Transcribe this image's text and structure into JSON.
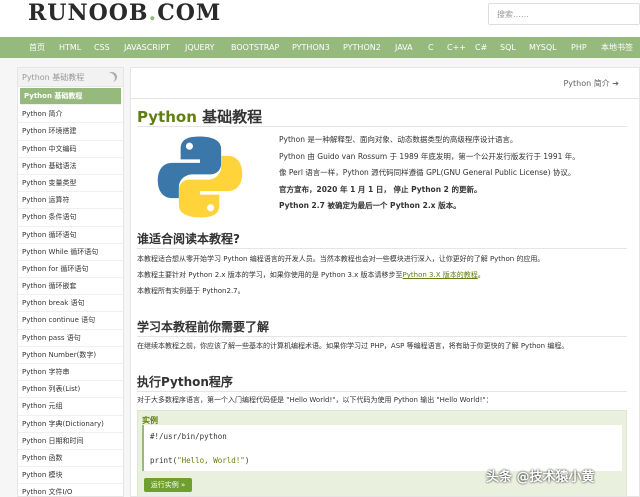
{
  "site": {
    "logo_main": "RUNOOB",
    "logo_dot": ".",
    "logo_tld": "COM",
    "search_placeholder": "搜索……"
  },
  "nav": [
    "首页",
    "HTML",
    "CSS",
    "JAVASCRIPT",
    "JQUERY",
    "BOOTSTRAP",
    "PYTHON3",
    "PYTHON2",
    "JAVA",
    "C",
    "C++",
    "C#",
    "SQL",
    "MYSQL",
    "PHP",
    "本地书签"
  ],
  "sidebar": {
    "title": "Python 基础教程",
    "items": [
      "Python 基础教程",
      "Python 简介",
      "Python 环境搭建",
      "Python 中文编码",
      "Python 基础语法",
      "Python 变量类型",
      "Python 运算符",
      "Python 条件语句",
      "Python 循环语句",
      "Python While 循环语句",
      "Python for 循环语句",
      "Python 循环嵌套",
      "Python break 语句",
      "Python continue 语句",
      "Python pass 语句",
      "Python Number(数字)",
      "Python 字符串",
      "Python 列表(List)",
      "Python 元组",
      "Python 字典(Dictionary)",
      "Python 日期和时间",
      "Python 函数",
      "Python 模块",
      "Python 文件I/O"
    ]
  },
  "main": {
    "next_link": "Python 简介 ➔",
    "title_part1": "Python",
    "title_part2": " 基础教程",
    "intro": [
      "Python 是一种解释型、面向对象、动态数据类型的高级程序设计语言。",
      "Python 由 Guido van Rossum 于 1989 年底发明，第一个公开发行版发行于 1991 年。",
      "像 Perl 语言一样，Python 源代码同样遵循 GPL(GNU General Public License) 协议。",
      "官方宣布，2020 年 1 月 1 日， 停止 Python 2 的更新。",
      "Python 2.7 被确定为最后一个 Python 2.x 版本。"
    ],
    "section1_title": "谁适合阅读本教程?",
    "section1_p1": "本教程适合想从零开始学习 Python 编程语言的开发人员。当然本教程也会对一些模块进行深入，让你更好的了解 Python 的应用。",
    "section1_p2_pre": "本教程主要针对 Python 2.x 版本的学习，如果你使用的是 Python 3.x 版本请移步至",
    "section1_p2_link": "Python 3.X 版本的教程",
    "section1_p2_post": "。",
    "section1_p3": "本教程所有实例基于 Python2.7。",
    "section2_title": "学习本教程前你需要了解",
    "section2_p": "在继续本教程之前，你应该了解一些基本的计算机编程术语。如果你学习过 PHP，ASP 等编程语言，将有助于你更快的了解 Python 编程。",
    "section3_title": "执行Python程序",
    "section3_p": "对于大多数程序语言，第一个入门编程代码便是 \"Hello World!\"，以下代码为使用 Python 输出 \"Hello World!\"：",
    "example_title": "实例",
    "code_line1": "#!/usr/bin/python",
    "code_line2_fn": "print(",
    "code_line2_str": "\"Hello, World!\"",
    "code_line2_end": ")",
    "run_button": "运行实例 »"
  },
  "watermark": "头条 @技术猿小黄",
  "colors": {
    "nav_green": "#96b97d",
    "title_green": "#617f10",
    "python_blue": "#3b77a8",
    "python_yellow": "#ffd43b"
  }
}
